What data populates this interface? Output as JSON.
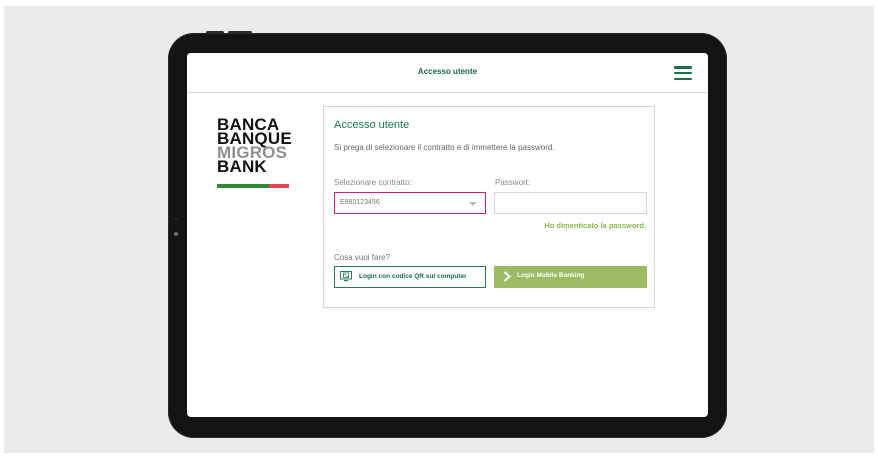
{
  "header": {
    "title": "Accesso utente"
  },
  "logo": {
    "lines": [
      "BANCA",
      "BANQUE",
      "MIGROS",
      "BANK"
    ]
  },
  "login": {
    "title": "Accesso utente",
    "description": "Si prega di selezionare il contratto e di immettere la password.",
    "contract_label": "Selezionare contratto:",
    "contract_value": "E880123456",
    "password_label": "Passwort:",
    "password_value": "",
    "forgot_link": "Ho dimenticato la password.",
    "action_prompt": "Cosa vuoi fare?",
    "qr_button": "Login con codice QR sul computer",
    "mobile_button": "Login Mobile Banking"
  },
  "colors": {
    "brand_green": "#1a7a55",
    "accent_lime": "#9cbb63",
    "focus_pink": "#d81f72",
    "logo_green": "#2f8a3a",
    "logo_red": "#e04a55"
  },
  "icons": {
    "menu": "hamburger-menu-icon",
    "qr": "computer-qr-icon",
    "arrow": "chevron-right-icon"
  }
}
